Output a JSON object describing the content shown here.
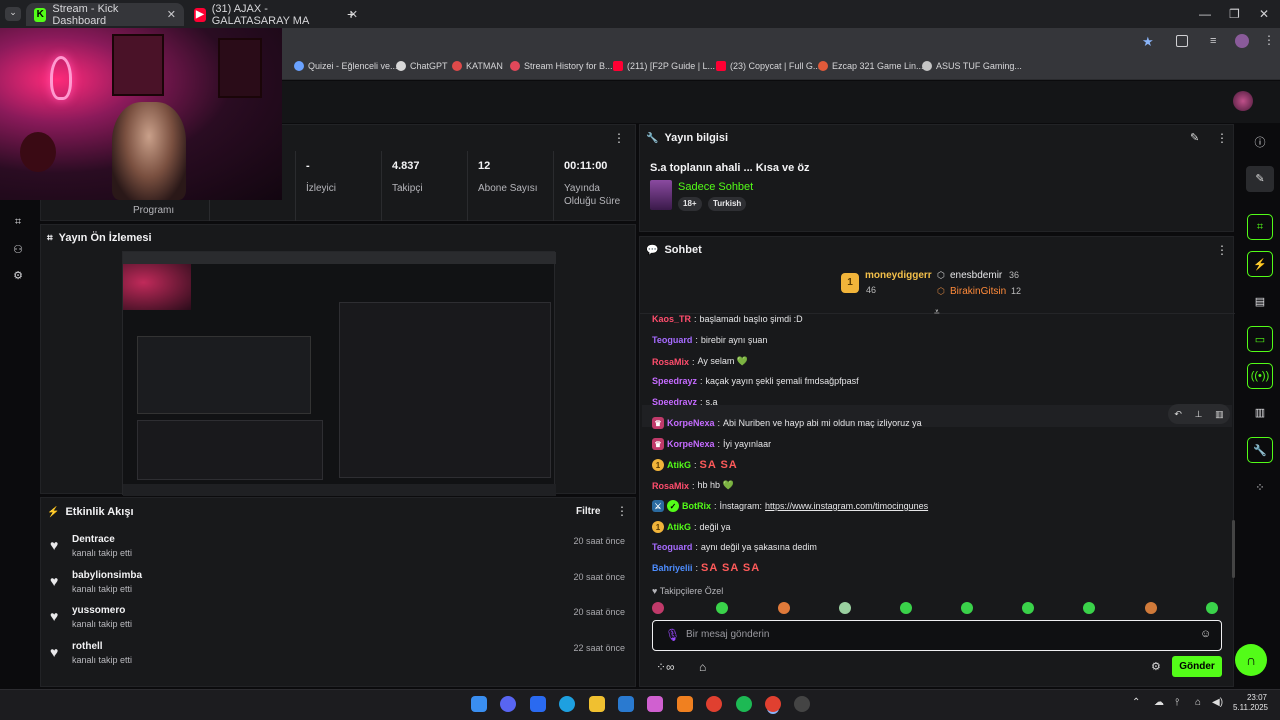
{
  "browser": {
    "tabs": [
      {
        "label": "Stream - Kick Dashboard",
        "active": true
      },
      {
        "label": "(31) AJAX - GALATASARAY MA",
        "active": false
      }
    ],
    "bookmarks": [
      "Quizei - Eğlenceli ve...",
      "ChatGPT",
      "KATMAN",
      "Stream History for B...",
      "(211) [F2P Guide | L...",
      "(23) Copycat | Full G...",
      "Ezcap 321 Game Lin...",
      "ASUS TUF Gaming..."
    ]
  },
  "colors": {
    "accent": "#53fc18",
    "panel": "#18191b",
    "background": "#0b0b0d"
  },
  "stats": {
    "partial_label": "Gelir Programı",
    "viewers": {
      "value": "-",
      "label": "İzleyici"
    },
    "followers": {
      "value": "4.837",
      "label": "Takipçi"
    },
    "subs": {
      "value": "12",
      "label": "Abone Sayısı"
    },
    "duration": {
      "value": "00:11:00",
      "label": "Yayında Olduğu Süre"
    }
  },
  "preview": {
    "title": "Yayın Ön İzlemesi"
  },
  "activity": {
    "title": "Etkinlik Akışı",
    "filter_label": "Filtre",
    "items": [
      {
        "name": "Dentrace",
        "desc": "kanalı takip etti",
        "time": "20 saat önce"
      },
      {
        "name": "babylionsimba",
        "desc": "kanalı takip etti",
        "time": "20 saat önce"
      },
      {
        "name": "yussomero",
        "desc": "kanalı takip etti",
        "time": "20 saat önce"
      },
      {
        "name": "rothell",
        "desc": "kanalı takip etti",
        "time": "22 saat önce"
      }
    ]
  },
  "stream_info": {
    "title": "Yayın bilgisi",
    "stream_title": "S.a toplanın ahali ... Kısa ve öz",
    "category": "Sadece Sohbet",
    "tags": [
      "18+",
      "Turkish"
    ]
  },
  "chat": {
    "title": "Sohbet",
    "leaderboard": {
      "first": {
        "name": "moneydiggerr",
        "count": "46",
        "rank": "1"
      },
      "second": {
        "name": "enesbdemir",
        "count": "36"
      },
      "third": {
        "name": "BirakinGitsin",
        "count": "12"
      }
    },
    "messages": [
      {
        "user": "Kaos_TR",
        "text": "başlamadı başlıo şimdi :D",
        "color": "#ff4d6d"
      },
      {
        "user": "Teoguard",
        "text": "birebir aynı şuan",
        "color": "#a66bff"
      },
      {
        "user": "RosaMix",
        "text": "Ay selam 💚",
        "color": "#ff4d6d"
      },
      {
        "user": "Speedrayz",
        "text": "kaçak yayın şekli şemali fmdsağpfpasf",
        "color": "#c56bff"
      },
      {
        "user": "Speedrayz",
        "text": "s.a",
        "color": "#c56bff"
      },
      {
        "user": "KorpeNexa",
        "text": "Abi Nuriben ve hayp abi mi oldun maç izliyoruz ya",
        "color": "#c56bff"
      },
      {
        "user": "KorpeNexa",
        "text": "İyi yayınlaar",
        "color": "#c56bff"
      },
      {
        "user": "AtikG",
        "text": "SA SA",
        "color": "#53fc18"
      },
      {
        "user": "RosaMix",
        "text": "hb hb 💚",
        "color": "#ff4d6d"
      },
      {
        "user": "BotRix",
        "text": "İnstagram:",
        "link": "https://www.instagram.com/timocingunes",
        "color": "#53fc18"
      },
      {
        "user": "AtikG",
        "text": "değil ya",
        "color": "#53fc18"
      },
      {
        "user": "Teoguard",
        "text": "aynı değil ya şakasına dedim",
        "color": "#a66bff"
      },
      {
        "user": "Bahriyelii",
        "text": "SA SA SA",
        "color": "#4d8dff"
      }
    ],
    "followers_only": "Takipçilere Özel",
    "input_placeholder": "Bir mesaj gönderin",
    "send_label": "Gönder"
  },
  "taskbar": {
    "time": "23:07",
    "date": "5.11.2025"
  }
}
